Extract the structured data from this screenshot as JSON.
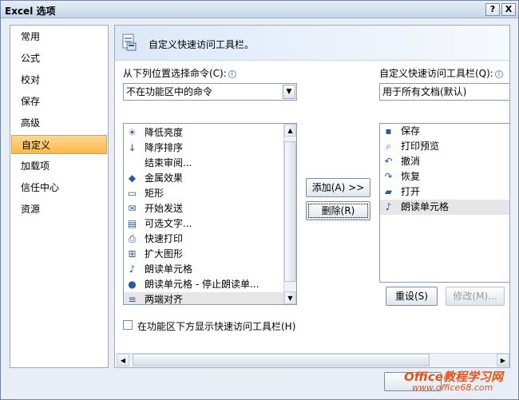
{
  "window": {
    "title": "Excel 选项",
    "help_label": "?",
    "close_label": "X"
  },
  "nav": {
    "items": [
      {
        "label": "常用"
      },
      {
        "label": "公式"
      },
      {
        "label": "校对"
      },
      {
        "label": "保存"
      },
      {
        "label": "高级"
      },
      {
        "label": "自定义",
        "selected": true
      },
      {
        "label": "加载项"
      },
      {
        "label": "信任中心"
      },
      {
        "label": "资源"
      }
    ]
  },
  "banner": {
    "text": "自定义快速访问工具栏。",
    "icon": "toolbar-customize-icon"
  },
  "left": {
    "choose_label": "从下列位置选择命令(C):",
    "choose_value": "不在功能区中的命令",
    "commands": [
      {
        "label": "降低亮度",
        "icon": "brightness-down-icon",
        "glyph": "☀"
      },
      {
        "label": "降序排序",
        "icon": "sort-desc-icon",
        "glyph": "↓"
      },
      {
        "label": "结束审阅...",
        "icon": "none",
        "glyph": ""
      },
      {
        "label": "金属效果",
        "icon": "metal-effect-icon",
        "glyph": "◆"
      },
      {
        "label": "矩形",
        "icon": "rectangle-icon",
        "glyph": "▭"
      },
      {
        "label": "开始发送",
        "icon": "send-icon",
        "glyph": "✉"
      },
      {
        "label": "可选文字...",
        "icon": "alt-text-icon",
        "glyph": "▤"
      },
      {
        "label": "快速打印",
        "icon": "quick-print-icon",
        "glyph": "⎙"
      },
      {
        "label": "扩大图形",
        "icon": "enlarge-icon",
        "glyph": "⊞"
      },
      {
        "label": "朗读单元格",
        "icon": "speak-cells-icon",
        "glyph": "♪"
      },
      {
        "label": "朗读单元格 - 停止朗读单...",
        "icon": "speak-stop-icon",
        "glyph": "●"
      },
      {
        "label": "两端对齐",
        "icon": "justify-icon",
        "glyph": "≡",
        "selected": true
      }
    ],
    "checkbox_label": "在功能区下方显示快速访问工具栏(H)"
  },
  "middle": {
    "add_label": "添加(A) >>",
    "remove_label": "删除(R)"
  },
  "right": {
    "toolbar_label": "自定义快速访问工具栏(Q):",
    "toolbar_value": "用于所有文档(默认)",
    "items": [
      {
        "label": "保存",
        "icon": "save-icon",
        "glyph": "▪"
      },
      {
        "label": "打印预览",
        "icon": "print-preview-icon",
        "glyph": "⌕"
      },
      {
        "label": "撤消",
        "icon": "undo-icon",
        "glyph": "↶"
      },
      {
        "label": "恢复",
        "icon": "redo-icon",
        "glyph": "↷"
      },
      {
        "label": "打开",
        "icon": "open-folder-icon",
        "glyph": "▰"
      },
      {
        "label": "朗读单元格",
        "icon": "speak-cells-icon",
        "glyph": "♪",
        "selected": true
      }
    ],
    "reset_label": "重设(S)",
    "modify_label": "修改(M)..."
  },
  "watermark": {
    "line1": "Office教程学习网",
    "line2": "www.office68.com"
  },
  "colors": {
    "selected_nav": "#ffb84a",
    "selected_row": "#e6e6e6",
    "accent": "#2a5aa0"
  }
}
